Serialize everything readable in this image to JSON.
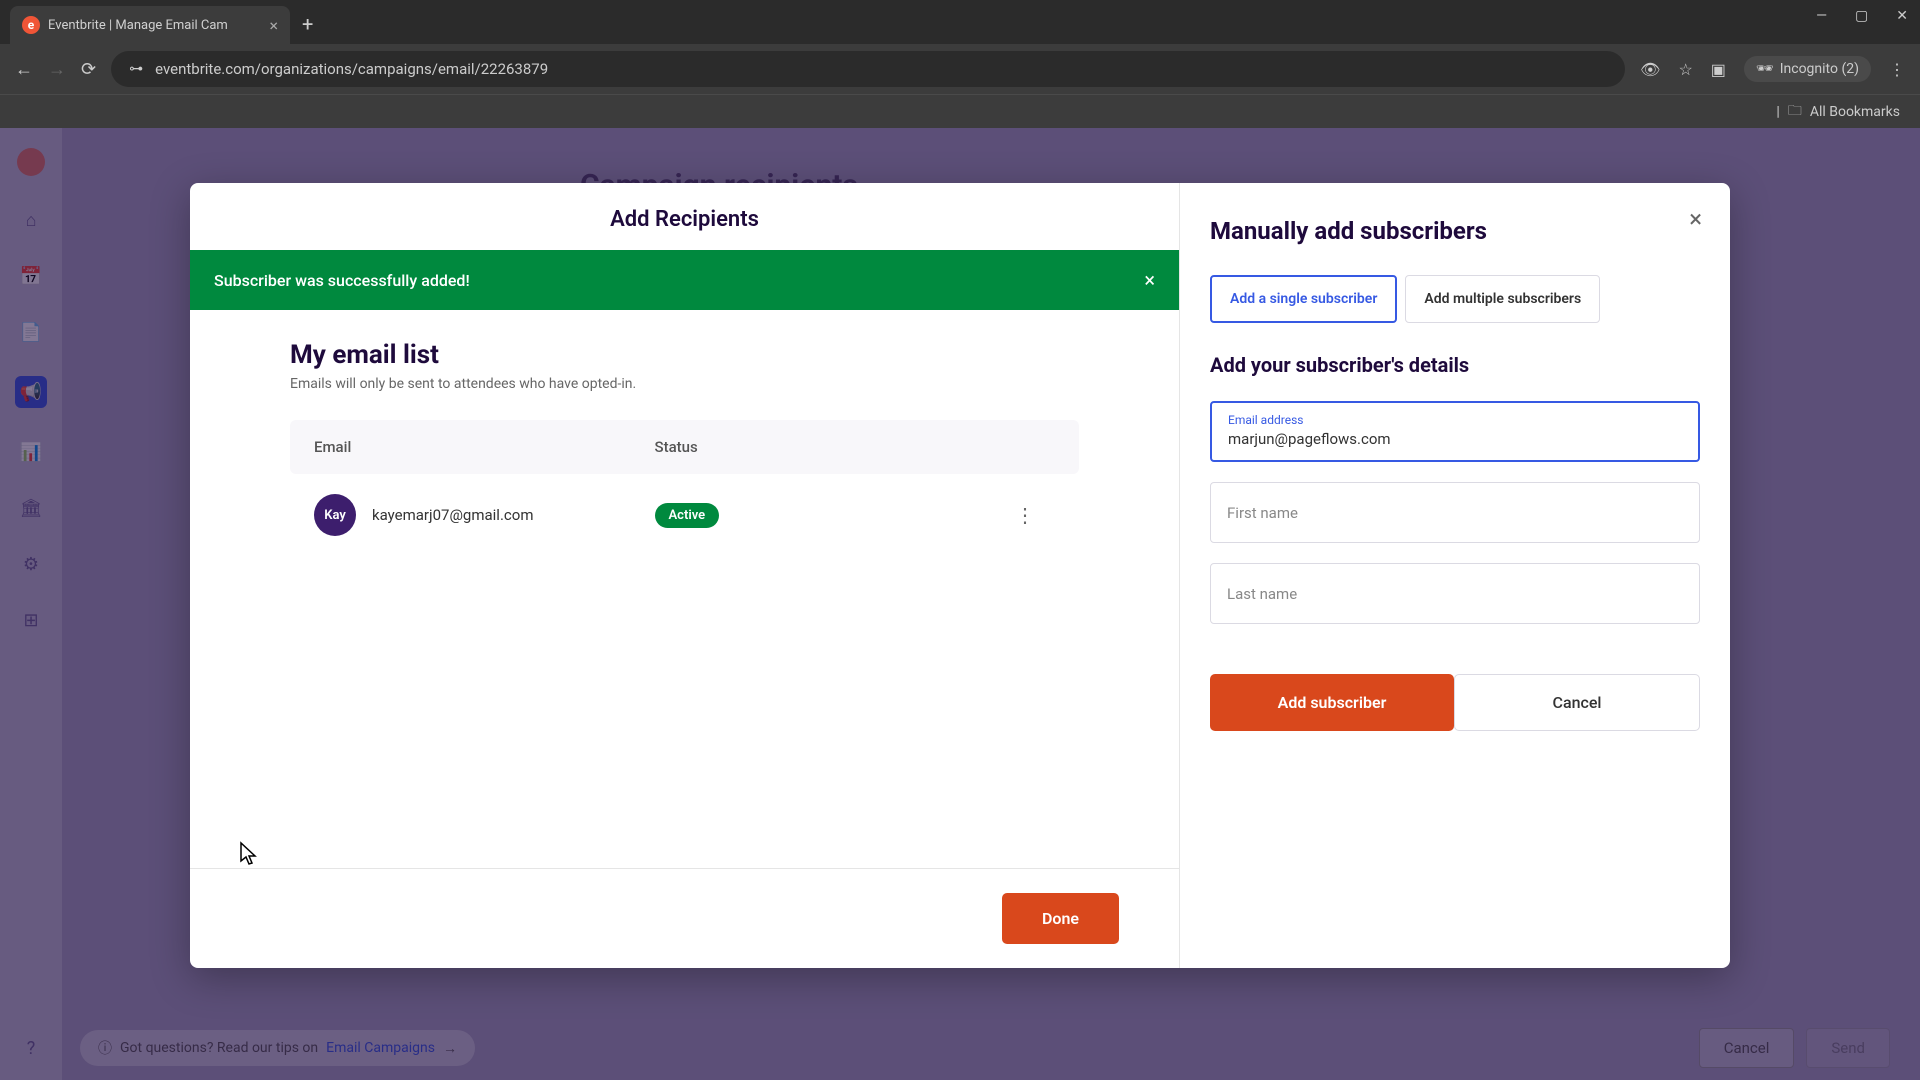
{
  "browser": {
    "tab_title": "Eventbrite | Manage Email Cam",
    "url": "eventbrite.com/organizations/campaigns/email/22263879",
    "incognito_label": "Incognito (2)",
    "bookmarks_label": "All Bookmarks"
  },
  "background": {
    "page_title": "Campaign recipients",
    "tips_text": "Got questions? Read our tips on ",
    "tips_link": "Email Campaigns",
    "cancel_label": "Cancel",
    "send_label": "Send"
  },
  "modal": {
    "title": "Add Recipients",
    "success_message": "Subscriber was successfully added!",
    "list_title": "My email list",
    "list_subtitle": "Emails will only be sent to attendees who have opted-in.",
    "columns": {
      "email": "Email",
      "status": "Status"
    },
    "rows": [
      {
        "avatar": "Kay",
        "email": "kayemarj07@gmail.com",
        "status": "Active"
      }
    ],
    "done_label": "Done"
  },
  "right_panel": {
    "title": "Manually add subscribers",
    "tab_single": "Add a single subscriber",
    "tab_multiple": "Add multiple subscribers",
    "details_title": "Add your subscriber's details",
    "email_label": "Email address",
    "email_value": "marjun@pageflows.com",
    "first_name_placeholder": "First name",
    "last_name_placeholder": "Last name",
    "add_subscriber_label": "Add subscriber",
    "cancel_label": "Cancel"
  }
}
